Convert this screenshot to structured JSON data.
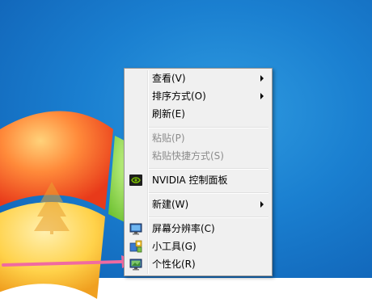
{
  "menu": {
    "items": [
      {
        "label": "查看(V)",
        "submenu": true,
        "disabled": false
      },
      {
        "label": "排序方式(O)",
        "submenu": true,
        "disabled": false
      },
      {
        "label": "刷新(E)",
        "submenu": false,
        "disabled": false
      },
      {
        "label": "粘贴(P)",
        "submenu": false,
        "disabled": true
      },
      {
        "label": "粘贴快捷方式(S)",
        "submenu": false,
        "disabled": true
      },
      {
        "label": "NVIDIA 控制面板",
        "submenu": false,
        "disabled": false,
        "icon": "nvidia-icon"
      },
      {
        "label": "新建(W)",
        "submenu": true,
        "disabled": false
      },
      {
        "label": "屏幕分辨率(C)",
        "submenu": false,
        "disabled": false,
        "icon": "monitor-icon"
      },
      {
        "label": "小工具(G)",
        "submenu": false,
        "disabled": false,
        "icon": "gadgets-icon"
      },
      {
        "label": "个性化(R)",
        "submenu": false,
        "disabled": false,
        "icon": "personalize-icon"
      }
    ]
  },
  "colors": {
    "desktop_blue": "#1a7fd0",
    "arrow_pink": "#f06aa0",
    "menu_bg": "#f0f0f0",
    "disabled_text": "#8d8d8d"
  }
}
